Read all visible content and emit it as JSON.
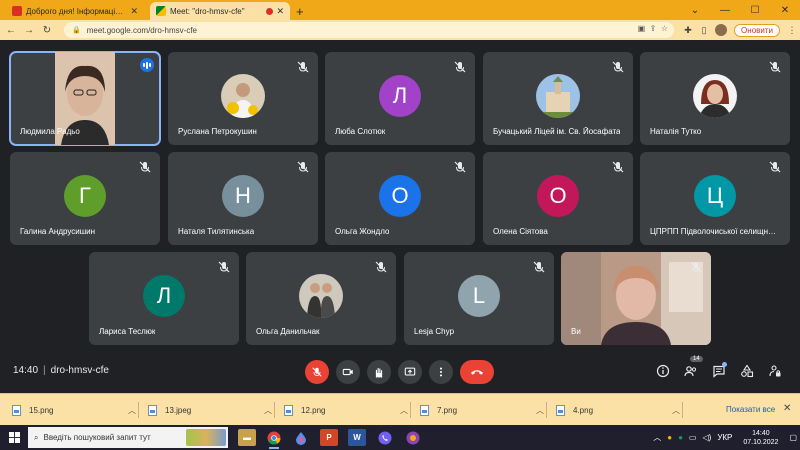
{
  "browser": {
    "tabs": [
      {
        "title": "Доброго дня! Інформаційне по",
        "active": false
      },
      {
        "title": "Meet: \"dro-hmsv-cfe\"",
        "active": true
      }
    ],
    "url": "meet.google.com/dro-hmsv-cfe",
    "update_label": "Оновити"
  },
  "meet": {
    "participants": [
      {
        "name": "Людмила Радьо",
        "kind": "video",
        "speaking": true
      },
      {
        "name": "Руслана Петрокушин",
        "kind": "photo"
      },
      {
        "name": "Люба Слотюк",
        "kind": "letter",
        "letter": "Л",
        "color": "#a142c8"
      },
      {
        "name": "Бучацький Ліцей ім. Св. Йосафата",
        "kind": "photo"
      },
      {
        "name": "Наталія Тутко",
        "kind": "photo"
      },
      {
        "name": "Галина Андрусишин",
        "kind": "letter",
        "letter": "Г",
        "color": "#5f9e2b"
      },
      {
        "name": "Наталя Тилятинська",
        "kind": "letter",
        "letter": "Н",
        "color": "#78909c"
      },
      {
        "name": "Ольга Жондло",
        "kind": "letter",
        "letter": "О",
        "color": "#1a73e8"
      },
      {
        "name": "Олена Сіятова",
        "kind": "letter",
        "letter": "О",
        "color": "#c2185b"
      },
      {
        "name": "ЦПРПП Підволочиської селищної ради",
        "kind": "letter",
        "letter": "Ц",
        "color": "#0097a7"
      },
      {
        "name": "Лариса Теслюк",
        "kind": "letter",
        "letter": "Л",
        "color": "#00796b"
      },
      {
        "name": "Ольга Данильчак",
        "kind": "photo"
      },
      {
        "name": "Lesja Chyp",
        "kind": "letter",
        "letter": "L",
        "color": "#90a4ae"
      },
      {
        "name": "Ви",
        "kind": "video-wide"
      }
    ],
    "time": "14:40",
    "code": "dro-hmsv-cfe",
    "people_count": "14"
  },
  "downloads": {
    "files": [
      "15.png",
      "13.jpeg",
      "12.png",
      "7.png",
      "4.png"
    ],
    "show_all_label": "Показати все"
  },
  "taskbar": {
    "search_placeholder": "Введіть пошуковий запит тут",
    "lang": "УКР",
    "time": "14:40",
    "date": "07.10.2022"
  }
}
